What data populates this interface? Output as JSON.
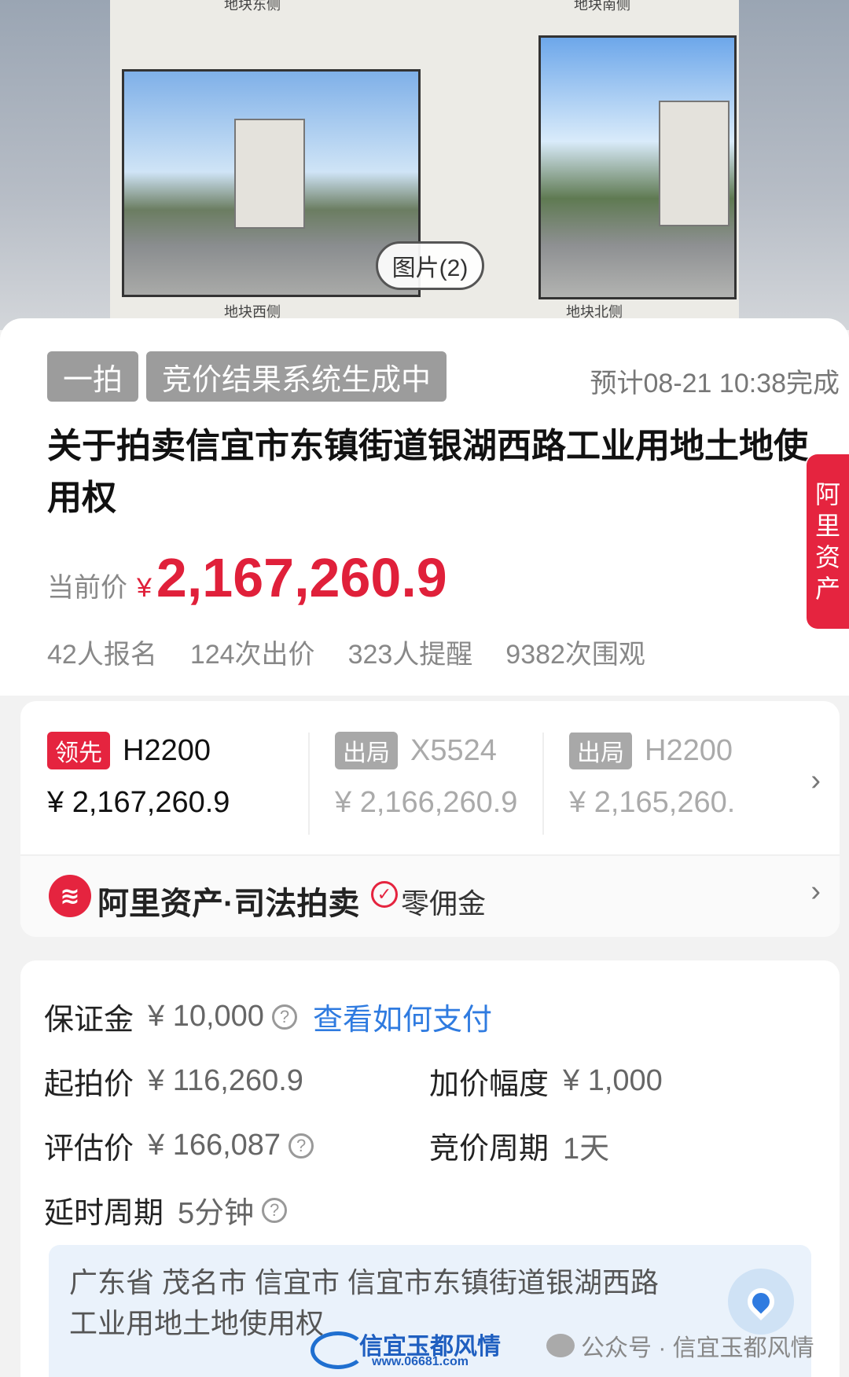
{
  "hero": {
    "captions": [
      "地块东侧",
      "地块南侧",
      "地块西侧",
      "地块北侧"
    ],
    "image_count_label": "图片(2)"
  },
  "auction": {
    "round_tag": "一拍",
    "status_tag": "竞价结果系统生成中",
    "eta_text": "预计08-21 10:38完成",
    "title": "关于拍卖信宜市东镇街道银湖西路工业用地土地使用权",
    "price_label": "当前价",
    "currency": "¥",
    "current_price": "2,167,260.9",
    "stats": [
      "42人报名",
      "124次出价",
      "323人提醒",
      "9382次围观"
    ]
  },
  "side_tab": {
    "chars": [
      "阿",
      "里",
      "资",
      "产"
    ]
  },
  "bids": [
    {
      "status": "领先",
      "bidder": "H2200",
      "amount": "¥ 2,167,260.9"
    },
    {
      "status": "出局",
      "bidder": "X5524",
      "amount": "¥ 2,166,260.9"
    },
    {
      "status": "出局",
      "bidder": "H2200",
      "amount": "¥ 2,165,260."
    }
  ],
  "brand": {
    "name": "阿里资产·司法拍卖",
    "fee_label": "零佣金"
  },
  "info": {
    "deposit_label": "保证金",
    "deposit_value": "¥ 10,000",
    "pay_link": "查看如何支付",
    "start_label": "起拍价",
    "start_value": "¥ 116,260.9",
    "increment_label": "加价幅度",
    "increment_value": "¥ 1,000",
    "appraisal_label": "评估价",
    "appraisal_value": "¥ 166,087",
    "cycle_label": "竞价周期",
    "cycle_value": "1天",
    "delay_label": "延时周期",
    "delay_value": "5分钟",
    "address": "广东省 茂名市 信宜市 信宜市东镇街道银湖西路工业用地土地使用权"
  },
  "watermark": {
    "site_title": "信宜玉都风情",
    "site_url": "www.06681.com",
    "wechat_text": "公众号 · 信宜玉都风情"
  },
  "colors": {
    "accent_red": "#e5243f",
    "link_blue": "#2f7be0"
  }
}
